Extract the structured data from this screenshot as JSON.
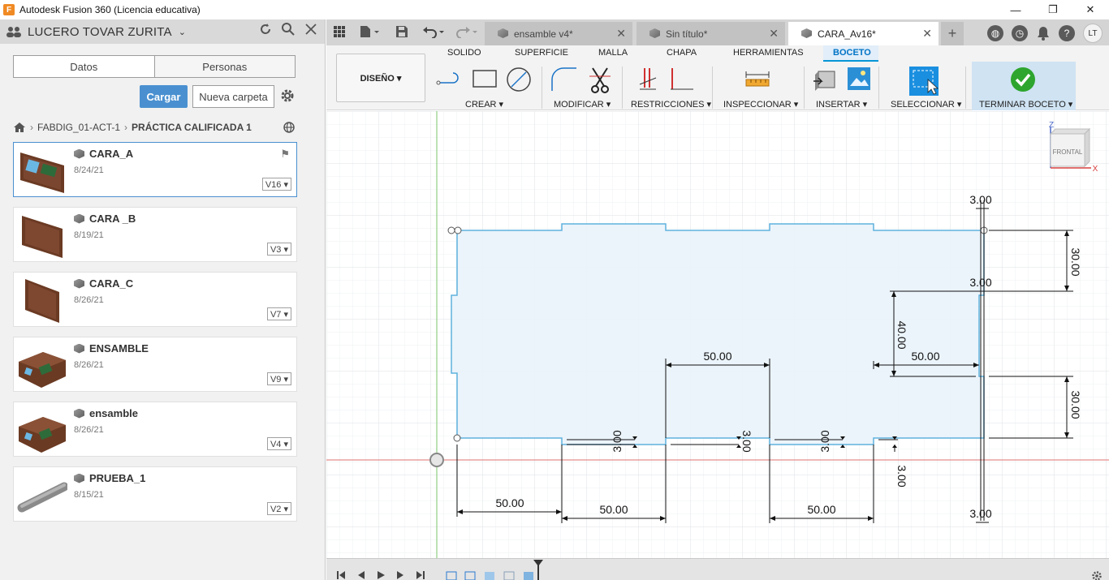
{
  "window": {
    "title": "Autodesk Fusion 360 (Licencia educativa)",
    "minimize": "—",
    "restore": "❐",
    "close": "✕"
  },
  "data_panel": {
    "user": "LUCERO TOVAR ZURITA",
    "tabs": [
      "Datos",
      "Personas"
    ],
    "upload_label": "Cargar",
    "new_folder_label": "Nueva carpeta",
    "breadcrumb": [
      "FABDIG_01-ACT-1",
      "PRÁCTICA CALIFICADA 1"
    ],
    "files": [
      {
        "name": "CARA_A",
        "date": "8/24/21",
        "version": "V16 ▾"
      },
      {
        "name": "CARA _B",
        "date": "8/19/21",
        "version": "V3 ▾"
      },
      {
        "name": "CARA_C",
        "date": "8/26/21",
        "version": "V7 ▾"
      },
      {
        "name": "ENSAMBLE",
        "date": "8/26/21",
        "version": "V9 ▾"
      },
      {
        "name": "ensamble",
        "date": "8/26/21",
        "version": "V4 ▾"
      },
      {
        "name": "PRUEBA_1",
        "date": "8/15/21",
        "version": "V2 ▾"
      }
    ]
  },
  "doc_tabs": [
    {
      "label": "ensamble v4*"
    },
    {
      "label": "Sin título*"
    },
    {
      "label": "CARA_Av16*"
    }
  ],
  "user_initials": "LT",
  "toolbar": {
    "workspace": "DISEÑO ▾",
    "tabs": [
      "SOLIDO",
      "SUPERFICIE",
      "MALLA",
      "CHAPA",
      "HERRAMIENTAS",
      "BOCETO"
    ],
    "groups": [
      "CREAR ▾",
      "MODIFICAR ▾",
      "RESTRICCIONES ▾",
      "INSPECCIONAR ▾",
      "INSERTAR ▾",
      "SELECCIONAR ▾",
      "TERMINAR BOCETO ▾"
    ]
  },
  "viewcube": {
    "face": "FRONTAL",
    "z_axis": "Z",
    "x_axis": "X"
  },
  "sketch_dimensions": {
    "top_offset": "3.00",
    "right_upper_height": "30.00",
    "right_notch_depth": "3.00",
    "slot_height": "40.00",
    "slot_width": "50.00",
    "middle_width": "50.00",
    "right_lower_height": "30.00",
    "notch_depth_1": "3.00",
    "notch_depth_2": "3.00",
    "notch_depth_3": "3.00",
    "notch_depth_4": "3.00",
    "bottom_width_1": "50.00",
    "bottom_width_2": "50.00",
    "bottom_width_3": "50.00",
    "bottom_right_offset": "3.00"
  }
}
